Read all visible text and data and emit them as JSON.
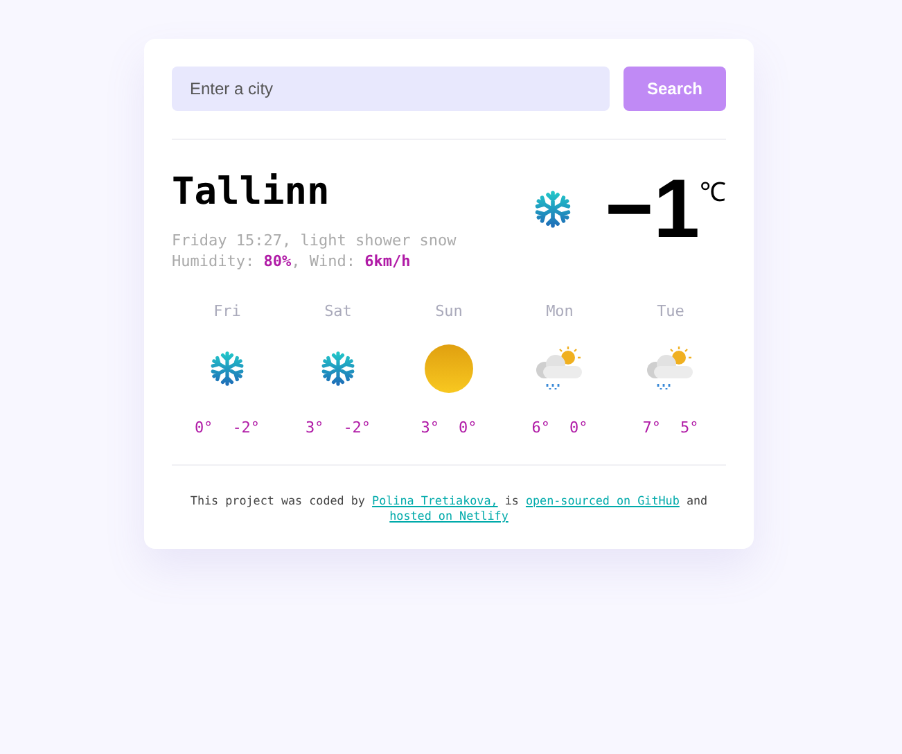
{
  "search": {
    "placeholder": "Enter a city",
    "button": "Search"
  },
  "current": {
    "city": "Tallinn",
    "description": "Friday 15:27, light shower snow",
    "humidity_label": "Humidity: ",
    "humidity": "80%",
    "wind_label": ", Wind: ",
    "wind": "6km/h",
    "kind": "snow",
    "temperature": "−1",
    "unit": "℃"
  },
  "forecast": [
    {
      "day": "Fri",
      "kind": "snow",
      "high": "0°",
      "low": "-2°"
    },
    {
      "day": "Sat",
      "kind": "snow",
      "high": "3°",
      "low": "-2°"
    },
    {
      "day": "Sun",
      "kind": "sun",
      "high": "3°",
      "low": "0°"
    },
    {
      "day": "Mon",
      "kind": "showers",
      "high": "6°",
      "low": "0°"
    },
    {
      "day": "Tue",
      "kind": "showers",
      "high": "7°",
      "low": "5°"
    }
  ],
  "footer": [
    {
      "kind": "text",
      "text": "This project was coded by "
    },
    {
      "kind": "link",
      "text": "Polina Tretiakova,"
    },
    {
      "kind": "text",
      "text": " is "
    },
    {
      "kind": "link",
      "text": "open-sourced on GitHub"
    },
    {
      "kind": "text",
      "text": " and "
    },
    {
      "kind": "link",
      "text": "hosted on Netlify"
    }
  ]
}
